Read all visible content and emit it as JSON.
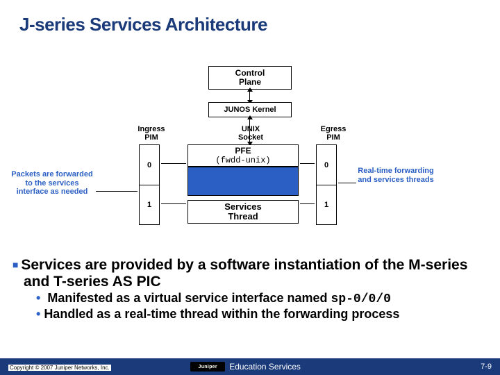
{
  "title": "J-series Services Architecture",
  "diagram": {
    "control_plane": "Control\nPlane",
    "kernel": "JUNOS Kernel",
    "ingress_label": "Ingress\nPIM",
    "unix_label": "UNIX\nSocket",
    "egress_label": "Egress\nPIM",
    "pfe_title": "PFE",
    "pfe_sub": "(fwdd-unix)",
    "services_thread": "Services\nThread",
    "port0": "0",
    "port1": "1",
    "note_left": "Packets are forwarded to the services interface as needed",
    "note_right": "Real-time forwarding and services threads"
  },
  "bullets": {
    "l1": "Services are provided by a software instantiation of the M-series and T-series AS PIC",
    "l2a_pre": "Manifested as a virtual service interface named ",
    "l2a_code": "sp-0/0/0",
    "l2b": "Handled as a real-time thread within the forwarding process"
  },
  "footer": {
    "copyright": "Copyright © 2007 Juniper Networks, Inc.",
    "brand": "Juniper",
    "center": "Education Services",
    "page": "7-9"
  }
}
